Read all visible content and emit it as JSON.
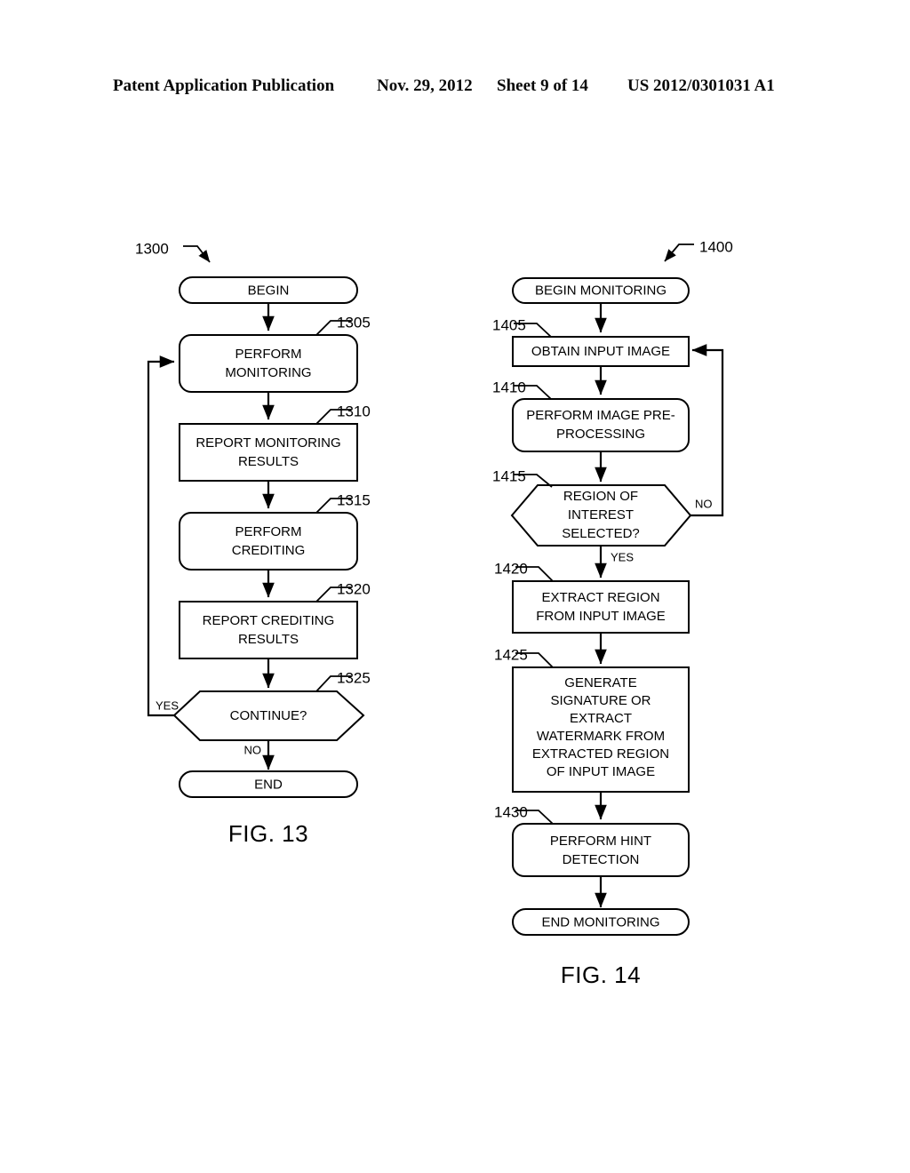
{
  "header": {
    "publication": "Patent Application Publication",
    "date": "Nov. 29, 2012",
    "sheet": "Sheet 9 of 14",
    "patent_number": "US 2012/0301031 A1"
  },
  "figures": [
    {
      "id": "fig13",
      "caption": "FIG. 13",
      "flow_ref": "1300",
      "nodes": [
        {
          "ref": "",
          "label": "BEGIN",
          "shape": "terminator"
        },
        {
          "ref": "1305",
          "label": "PERFORM MONITORING",
          "shape": "rounded-rect"
        },
        {
          "ref": "1310",
          "label": "REPORT MONITORING RESULTS",
          "shape": "rect"
        },
        {
          "ref": "1315",
          "label": "PERFORM CREDITING",
          "shape": "rounded-rect"
        },
        {
          "ref": "1320",
          "label": "REPORT CREDITING RESULTS",
          "shape": "rect"
        },
        {
          "ref": "1325",
          "label": "CONTINUE?",
          "shape": "hexagon"
        },
        {
          "ref": "",
          "label": "END",
          "shape": "terminator"
        }
      ],
      "branch_labels": {
        "yes": "YES",
        "no": "NO"
      }
    },
    {
      "id": "fig14",
      "caption": "FIG. 14",
      "flow_ref": "1400",
      "nodes": [
        {
          "ref": "",
          "label": "BEGIN MONITORING",
          "shape": "terminator"
        },
        {
          "ref": "1405",
          "label": "OBTAIN INPUT IMAGE",
          "shape": "rect"
        },
        {
          "ref": "1410",
          "label": "PERFORM IMAGE PRE-PROCESSING",
          "shape": "rounded-rect"
        },
        {
          "ref": "1415",
          "label": "REGION OF INTEREST SELECTED?",
          "shape": "hexagon"
        },
        {
          "ref": "1420",
          "label": "EXTRACT REGION FROM INPUT IMAGE",
          "shape": "rect"
        },
        {
          "ref": "1425",
          "label": "GENERATE SIGNATURE OR EXTRACT WATERMARK FROM EXTRACTED REGION OF INPUT IMAGE",
          "shape": "rect"
        },
        {
          "ref": "1430",
          "label": "PERFORM HINT DETECTION",
          "shape": "rounded-rect"
        },
        {
          "ref": "",
          "label": "END MONITORING",
          "shape": "terminator"
        }
      ],
      "branch_labels": {
        "yes": "YES",
        "no": "NO"
      }
    }
  ],
  "fig13_lines": {
    "n0": [
      "BEGIN"
    ],
    "n1": [
      "PERFORM",
      "MONITORING"
    ],
    "n2": [
      "REPORT MONITORING",
      "RESULTS"
    ],
    "n3": [
      "PERFORM",
      "CREDITING"
    ],
    "n4": [
      "REPORT CREDITING",
      "RESULTS"
    ],
    "n5": [
      "CONTINUE?"
    ],
    "n6": [
      "END"
    ]
  },
  "fig14_lines": {
    "n0": [
      "BEGIN MONITORING"
    ],
    "n1": [
      "OBTAIN INPUT IMAGE"
    ],
    "n2": [
      "PERFORM IMAGE PRE-",
      "PROCESSING"
    ],
    "n3": [
      "REGION OF",
      "INTEREST",
      "SELECTED?"
    ],
    "n4": [
      "EXTRACT REGION",
      "FROM INPUT IMAGE"
    ],
    "n5": [
      "GENERATE",
      "SIGNATURE OR",
      "EXTRACT",
      "WATERMARK FROM",
      "EXTRACTED REGION",
      "OF INPUT IMAGE"
    ],
    "n6": [
      "PERFORM HINT",
      "DETECTION"
    ],
    "n7": [
      "END MONITORING"
    ]
  },
  "colors": {
    "ink": "#000000",
    "paper": "#ffffff"
  }
}
